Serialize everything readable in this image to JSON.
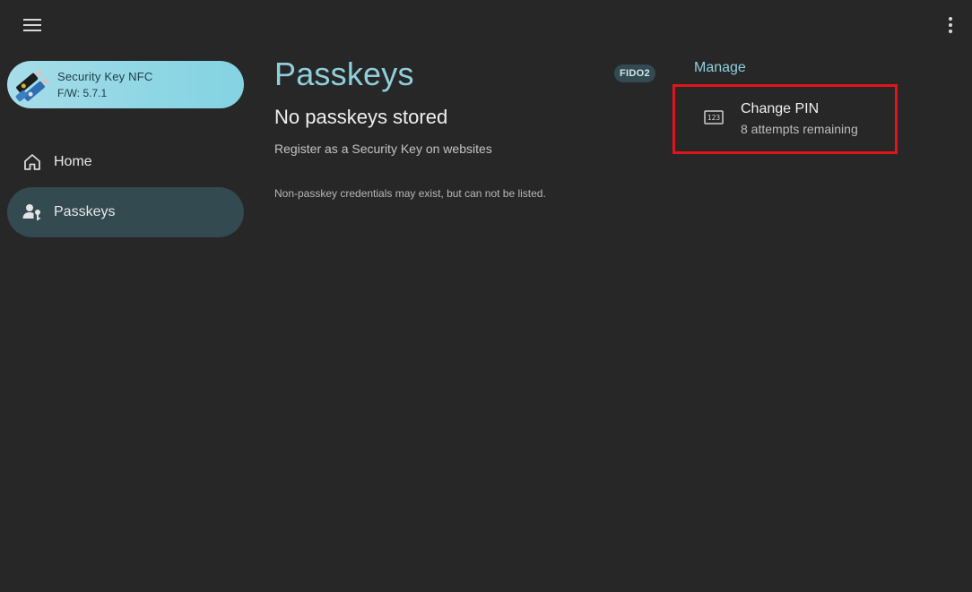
{
  "device": {
    "name": "Security Key NFC",
    "firmware": "F/W: 5.7.1"
  },
  "nav": {
    "items": [
      {
        "label": "Home",
        "icon": "home-icon"
      },
      {
        "label": "Passkeys",
        "icon": "passkey-icon",
        "selected": true
      }
    ]
  },
  "main": {
    "title": "Passkeys",
    "badge": "FIDO2",
    "empty_title": "No passkeys stored",
    "empty_subtitle": "Register as a Security Key on websites",
    "note": "Non-passkey credentials may exist, but can not be listed."
  },
  "manage": {
    "title": "Manage",
    "change_pin": {
      "title": "Change PIN",
      "subtitle": "8 attempts remaining",
      "icon": "pin-123-icon"
    }
  },
  "colors": {
    "accent": "#8fcfdc",
    "background": "#272727",
    "selected_nav": "#334a50",
    "highlight_border": "#e0141c"
  }
}
